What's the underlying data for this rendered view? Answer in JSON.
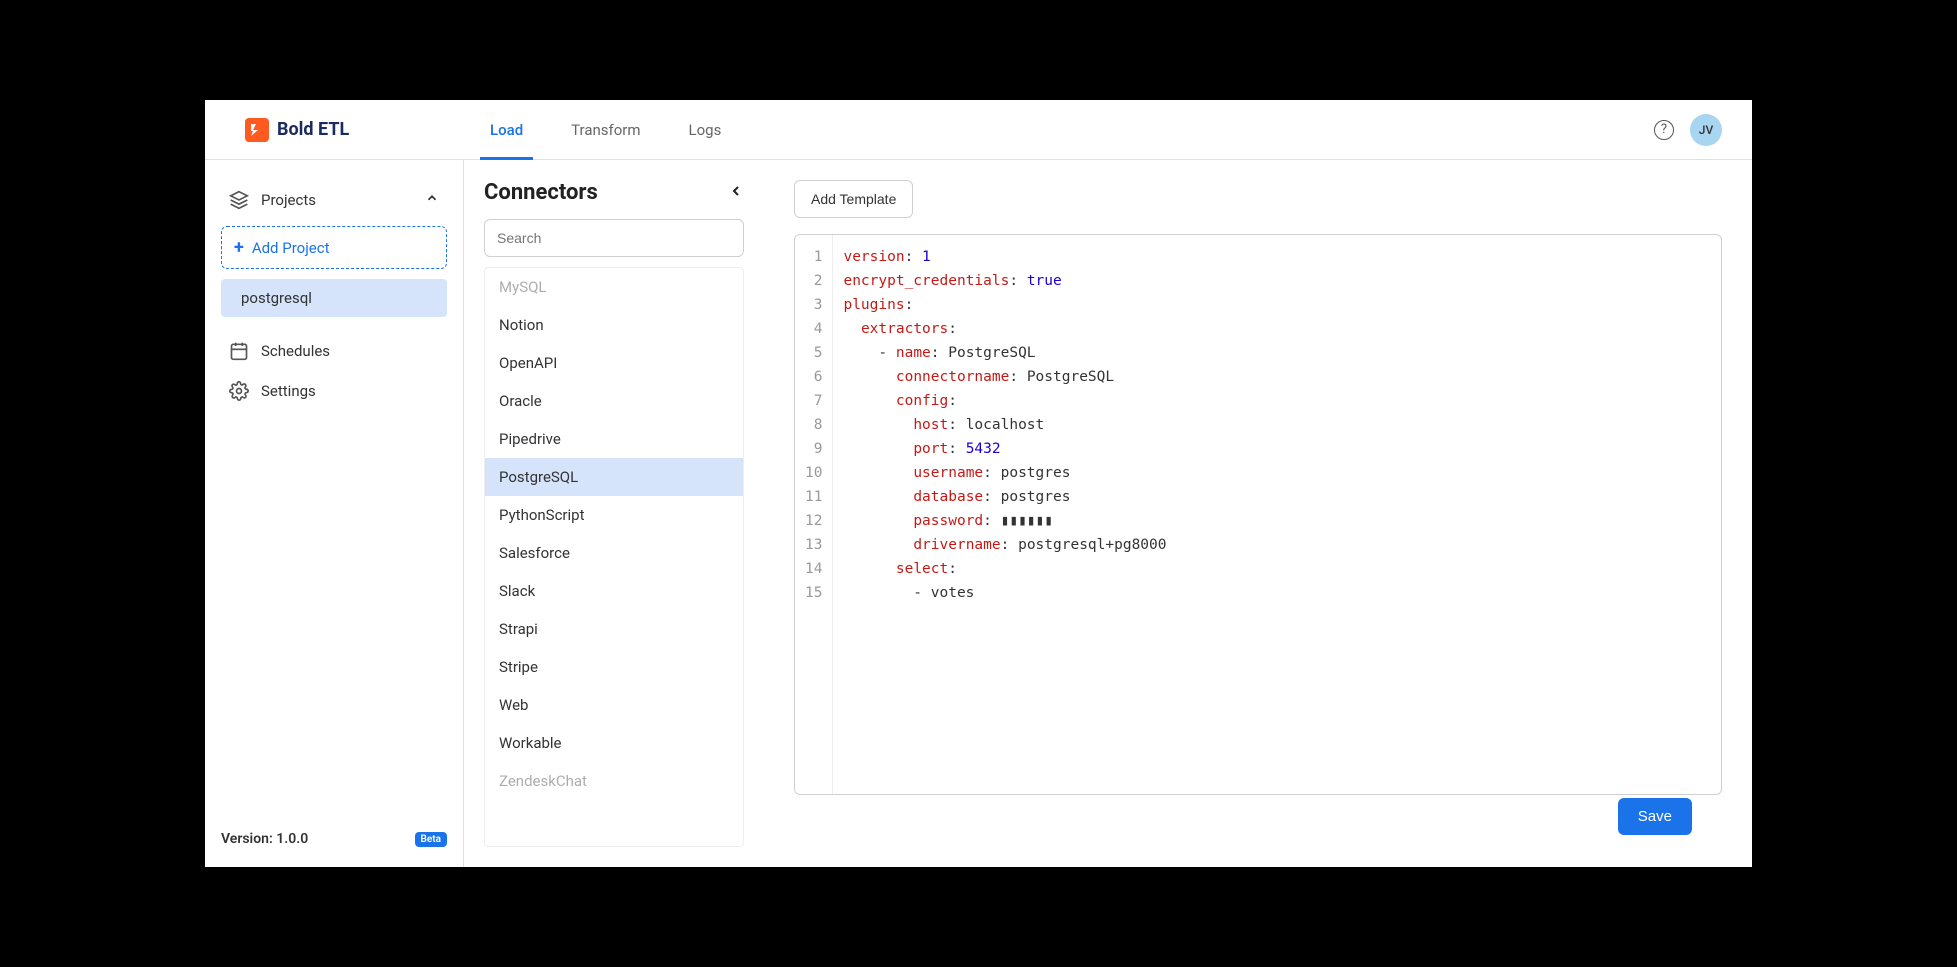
{
  "app": {
    "name": "Bold ETL",
    "avatar": "JV"
  },
  "tabs": {
    "load": "Load",
    "transform": "Transform",
    "logs": "Logs"
  },
  "sidebar": {
    "projects_label": "Projects",
    "add_project": "Add Project",
    "selected_project": "postgresql",
    "schedules": "Schedules",
    "settings": "Settings",
    "version_label": "Version: 1.0.0",
    "beta": "Beta"
  },
  "connectors": {
    "title": "Connectors",
    "search_placeholder": "Search",
    "items": [
      {
        "label": "MySQL",
        "faded": true
      },
      {
        "label": "Notion"
      },
      {
        "label": "OpenAPI"
      },
      {
        "label": "Oracle"
      },
      {
        "label": "Pipedrive"
      },
      {
        "label": "PostgreSQL",
        "selected": true
      },
      {
        "label": "PythonScript"
      },
      {
        "label": "Salesforce"
      },
      {
        "label": "Slack"
      },
      {
        "label": "Strapi"
      },
      {
        "label": "Stripe"
      },
      {
        "label": "Web"
      },
      {
        "label": "Workable"
      },
      {
        "label": "ZendeskChat",
        "faded": true
      }
    ]
  },
  "main": {
    "add_template": "Add Template",
    "save": "Save",
    "code": {
      "lines": 15,
      "version": "1",
      "encrypt": "true",
      "name": "PostgreSQL",
      "connectorname": "PostgreSQL",
      "host": "localhost",
      "port": "5432",
      "username": "postgres",
      "database": "postgres",
      "password": "▮▮▮▮▮▮",
      "drivername": "postgresql+pg8000",
      "select_item": "votes"
    }
  }
}
